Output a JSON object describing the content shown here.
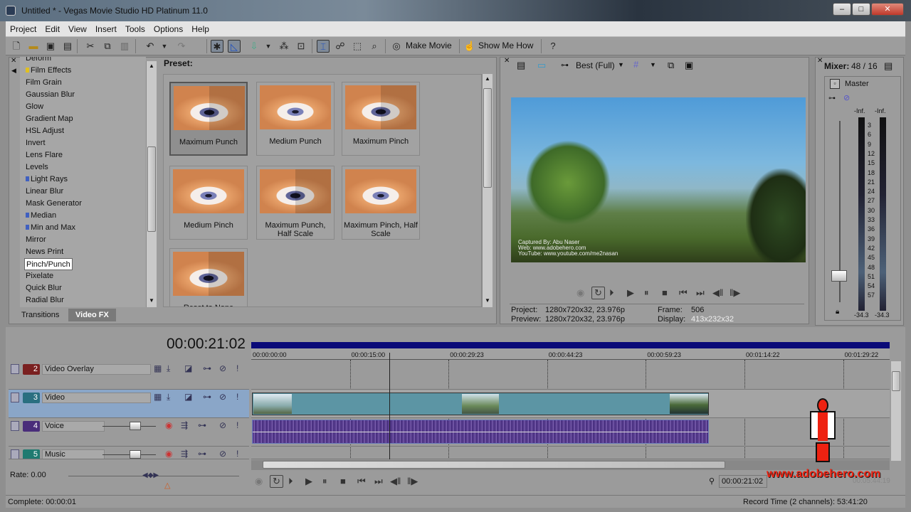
{
  "window": {
    "title": "Untitled * - Vegas Movie Studio HD Platinum 11.0",
    "min": "–",
    "max": "□",
    "close": "✕"
  },
  "menu": [
    "Project",
    "Edit",
    "View",
    "Insert",
    "Tools",
    "Options",
    "Help"
  ],
  "toolbar": {
    "make_movie": "Make Movie",
    "show_me_how": "Show Me How"
  },
  "fx": {
    "items": [
      {
        "label": "Deform",
        "mark": ""
      },
      {
        "label": "Film Effects",
        "mark": "#e0c020"
      },
      {
        "label": "Film Grain",
        "mark": ""
      },
      {
        "label": "Gaussian Blur",
        "mark": ""
      },
      {
        "label": "Glow",
        "mark": ""
      },
      {
        "label": "Gradient Map",
        "mark": ""
      },
      {
        "label": "HSL Adjust",
        "mark": ""
      },
      {
        "label": "Invert",
        "mark": ""
      },
      {
        "label": "Lens Flare",
        "mark": ""
      },
      {
        "label": "Levels",
        "mark": ""
      },
      {
        "label": "Light Rays",
        "mark": "#4060c0"
      },
      {
        "label": "Linear Blur",
        "mark": ""
      },
      {
        "label": "Mask Generator",
        "mark": ""
      },
      {
        "label": "Median",
        "mark": "#4060c0"
      },
      {
        "label": "Min and Max",
        "mark": "#4060c0"
      },
      {
        "label": "Mirror",
        "mark": ""
      },
      {
        "label": "News Print",
        "mark": ""
      },
      {
        "label": "Pinch/Punch",
        "mark": "",
        "selected": true
      },
      {
        "label": "Pixelate",
        "mark": ""
      },
      {
        "label": "Quick Blur",
        "mark": ""
      },
      {
        "label": "Radial Blur",
        "mark": ""
      }
    ],
    "tabs": [
      "Transitions",
      "Video FX"
    ],
    "active_tab": "Video FX"
  },
  "presets": {
    "label": "Preset:",
    "items": [
      "Maximum Punch",
      "Medium Punch",
      "Maximum Pinch",
      "Medium Pinch",
      "Maximum Punch, Half Scale",
      "Maximum Pinch, Half Scale",
      "Reset to None"
    ]
  },
  "preview": {
    "quality": "Best (Full)",
    "overlay_lines": [
      "Captured By: Abu Naser",
      "Web: www.adobehero.com",
      "YouTube: www.youtube.com/me2nasan"
    ],
    "project_label": "Project:",
    "project": "1280x720x32, 23.976p",
    "preview_label": "Preview:",
    "preview": "1280x720x32, 23.976p",
    "frame_label": "Frame:",
    "frame": "506",
    "display_label": "Display:",
    "display": "413x232x32"
  },
  "mixer": {
    "title": "Mixer:",
    "value": "48 / 16",
    "master": "Master",
    "peak_l": "-Inf.",
    "peak_r": "-Inf.",
    "scale": [
      "3",
      "6",
      "9",
      "12",
      "15",
      "18",
      "21",
      "24",
      "27",
      "30",
      "33",
      "36",
      "39",
      "42",
      "45",
      "48",
      "51",
      "54",
      "57"
    ],
    "level_l": "-34.3",
    "level_r": "-34.3"
  },
  "timeline": {
    "timecode": "00:00:21:02",
    "ruler": [
      "00:00:00:00",
      "00:00:15:00",
      "00:00:29:23",
      "00:00:44:23",
      "00:00:59:23",
      "00:01:14:22",
      "00:01:29:22"
    ],
    "tracks": [
      {
        "num": "2",
        "name": "Video Overlay",
        "color": "#7a2020",
        "type": "video"
      },
      {
        "num": "3",
        "name": "Video",
        "color": "#2a6f80",
        "type": "video"
      },
      {
        "num": "4",
        "name": "Voice",
        "color": "#4a2d7a",
        "type": "audio"
      },
      {
        "num": "5",
        "name": "Music",
        "color": "#1f7a70",
        "type": "audio"
      }
    ],
    "rate": "Rate: 0.00",
    "cursor_time": "00:00:21:02",
    "end_time": "00:05:44:19"
  },
  "status": {
    "complete": "Complete: 00:00:01",
    "record_time": "Record Time (2 channels): 53:41:20"
  },
  "watermark": "www.adobehero.com"
}
